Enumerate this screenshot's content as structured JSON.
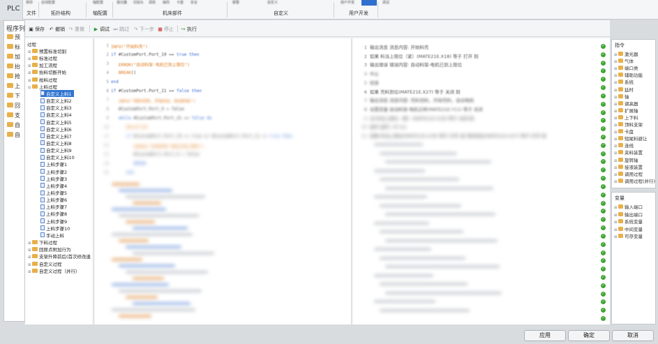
{
  "window": {
    "title": "PLC"
  },
  "ribbon": {
    "blurred_top": [
      "保存",
      "总线配置",
      "轴配置",
      "激光器",
      "切割头",
      "调高",
      "抽风",
      "卡盘",
      "安全",
      "报警",
      "自定义",
      "用户开发",
      "调试"
    ],
    "groups": [
      "文件",
      "拓扑结构",
      "轴配置",
      "机床部件",
      "自定义",
      "用户开发"
    ]
  },
  "left_panel": {
    "title": "程序列表",
    "items": [
      "预",
      "标",
      "加",
      "抬",
      "抢",
      "上",
      "下",
      "回",
      "支",
      "自",
      "自"
    ]
  },
  "toolbar": {
    "save": "保存",
    "undo": "撤销",
    "redo": "重做",
    "debug": "调试",
    "skip": "跳过",
    "step": "下一步",
    "stop": "停止",
    "run": "执行"
  },
  "tree": {
    "root": "过程",
    "items": [
      {
        "label": "预置标准切割",
        "level": 1,
        "kind": "folder",
        "tog": "+"
      },
      {
        "label": "标准过程",
        "level": 1,
        "kind": "folder",
        "tog": "+"
      },
      {
        "label": "加工流程",
        "level": 1,
        "kind": "folder",
        "tog": "+"
      },
      {
        "label": "抬料切断开始",
        "level": 1,
        "kind": "folder",
        "tog": "+"
      },
      {
        "label": "抢料过程",
        "level": 1,
        "kind": "folder",
        "tog": "+"
      },
      {
        "label": "上料过程",
        "level": 1,
        "kind": "folder",
        "tog": "-"
      },
      {
        "label": "自定义上料1",
        "level": 2,
        "kind": "doc",
        "selected": true
      },
      {
        "label": "自定义上料2",
        "level": 2,
        "kind": "doc"
      },
      {
        "label": "自定义上料3",
        "level": 2,
        "kind": "doc"
      },
      {
        "label": "自定义上料4",
        "level": 2,
        "kind": "doc"
      },
      {
        "label": "自定义上料5",
        "level": 2,
        "kind": "doc"
      },
      {
        "label": "自定义上料6",
        "level": 2,
        "kind": "doc"
      },
      {
        "label": "自定义上料7",
        "level": 2,
        "kind": "doc"
      },
      {
        "label": "自定义上料8",
        "level": 2,
        "kind": "doc"
      },
      {
        "label": "自定义上料9",
        "level": 2,
        "kind": "doc"
      },
      {
        "label": "自定义上料10",
        "level": 2,
        "kind": "doc"
      },
      {
        "label": "上料步骤1",
        "level": 2,
        "kind": "doc"
      },
      {
        "label": "上料步骤2",
        "level": 2,
        "kind": "doc"
      },
      {
        "label": "上料步骤3",
        "level": 2,
        "kind": "doc"
      },
      {
        "label": "上料步骤4",
        "level": 2,
        "kind": "doc"
      },
      {
        "label": "上料步骤5",
        "level": 2,
        "kind": "doc"
      },
      {
        "label": "上料步骤6",
        "level": 2,
        "kind": "doc"
      },
      {
        "label": "上料步骤7",
        "level": 2,
        "kind": "doc"
      },
      {
        "label": "上料步骤8",
        "level": 2,
        "kind": "doc"
      },
      {
        "label": "上料步骤9",
        "level": 2,
        "kind": "doc"
      },
      {
        "label": "上料步骤10",
        "level": 2,
        "kind": "doc"
      },
      {
        "label": "手动上料",
        "level": 2,
        "kind": "doc"
      },
      {
        "label": "下料过程",
        "level": 1,
        "kind": "folder",
        "tog": "+"
      },
      {
        "label": "回原点附加行为",
        "level": 1,
        "kind": "folder",
        "tog": "+"
      },
      {
        "label": "支架升降前后(首次修改逢",
        "level": 1,
        "kind": "folder",
        "tog": "+"
      },
      {
        "label": "自定义过程",
        "level": 1,
        "kind": "folder",
        "tog": "+"
      },
      {
        "label": "自定义过程（并行）",
        "level": 1,
        "kind": "folder",
        "tog": "+"
      }
    ]
  },
  "code": {
    "lines": [
      {
        "n": "1",
        "html": "<span class='st'>INFO(\"开始料壳\")</span>",
        "blur": 1
      },
      {
        "n": "2",
        "html": "<span class='kw'>if</span> <span class='pl'>#CustomPort.Port_19 ==</span> <span class='kw'>true then</span>",
        "blur": 1
      },
      {
        "n": "3",
        "html": "&nbsp;&nbsp;&nbsp;<span class='st'>ERROR(\"自动料架-电机已到上限位\")</span>",
        "blur": 1
      },
      {
        "n": "4",
        "html": "&nbsp;&nbsp;&nbsp;<span class='st'>BREAK</span><span class='pl'>()</span>",
        "blur": 1
      },
      {
        "n": "5",
        "html": "<span class='kw'>end</span>",
        "blur": 1
      },
      {
        "n": "6",
        "html": "<span class='kw'>if</span> <span class='pl'>#CustomPort.Port_21 ==</span> <span class='kw'>false then</span>",
        "blur": 1
      },
      {
        "n": "7",
        "html": "&nbsp;&nbsp;&nbsp;<span class='st'>INFO(\"壳料完料，开始向0，自动料机\")</span>",
        "blur": 2
      },
      {
        "n": "8",
        "html": "&nbsp;&nbsp;&nbsp;<span class='pl'>#CustomPort.Port_9 = false</span>",
        "blur": 2
      },
      {
        "n": "9",
        "html": "&nbsp;&nbsp;&nbsp;<span class='kw'>while</span> <span class='pl'>#CustomPort.Port_21 ==</span> <span class='kw'>false do</span>",
        "blur": 2
      },
      {
        "n": "10",
        "html": "&nbsp;&nbsp;&nbsp;&nbsp;&nbsp;&nbsp;<span class='st'>DELAY(20)</span>",
        "blur": 3
      },
      {
        "n": "11",
        "html": "&nbsp;&nbsp;&nbsp;&nbsp;&nbsp;&nbsp;<span class='kw'>if</span> <span class='pl'>#CustomPort.Port_19 == true or #CustomPort.Port_21 ==</span> <span class='kw'>true then</span>",
        "blur": 3
      },
      {
        "n": "12",
        "html": "&nbsp;&nbsp;&nbsp;&nbsp;&nbsp;&nbsp;&nbsp;&nbsp;&nbsp;<span class='st'>ERROR(\"自动料架-电机已到上限位\")</span>",
        "blur": 3
      },
      {
        "n": "13",
        "html": "&nbsp;&nbsp;&nbsp;&nbsp;&nbsp;&nbsp;&nbsp;&nbsp;&nbsp;<span class='pl'>#CustomPort.Port_9 = false</span>",
        "blur": 3
      },
      {
        "n": "14",
        "html": "&nbsp;&nbsp;&nbsp;&nbsp;&nbsp;&nbsp;&nbsp;&nbsp;&nbsp;<span class='kw'>BREAK</span>",
        "blur": 3
      },
      {
        "n": "15",
        "html": "&nbsp;&nbsp;&nbsp;&nbsp;&nbsp;&nbsp;<span class='kw'>end</span>",
        "blur": 3
      }
    ]
  },
  "desc": {
    "lines": [
      {
        "n": "1",
        "text": "输出消息  消息内容: 开始料壳",
        "blur": 1
      },
      {
        "n": "2",
        "text": "如果 料当上限位（紧）(MATE21E.X18) 等于 打开 则",
        "blur": 1
      },
      {
        "n": "3",
        "text": "输出错误  错误内容: 自动料架-电机已到上限位",
        "blur": 1
      },
      {
        "n": "4",
        "text": "中止",
        "blur": 2
      },
      {
        "n": "5",
        "text": "结束",
        "blur": 2
      },
      {
        "n": "6",
        "text": "如果 壳料到位(MATE21E.X27) 等于 关闭 则",
        "blur": 1
      },
      {
        "n": "7",
        "text": "输出消息  消息内容: 壳料完料，开始壳料，自动电机",
        "blur": 2
      },
      {
        "n": "8",
        "text": "设置变量 自动料架-电机正转(MATE21E.Y11) 等于 关闭",
        "blur": 2
      },
      {
        "n": "9",
        "text": "当 料当上限位（紧）(MATE21E.X18) 等于 关闭 则",
        "blur": 3
      },
      {
        "n": "10",
        "text": "延时 延时: 20 ms",
        "blur": 3
      },
      {
        "n": "11",
        "text": "如果 料当上限位(MATE21E.X18) 等于 打开 或 壳料到位(MATE21E.X27) 等于 打开 则",
        "blur": 3
      }
    ],
    "check_count": 34
  },
  "instructions_panel": {
    "title": "指令",
    "items": [
      "激光器",
      "气体",
      "端口类",
      "辅助功能",
      "系统",
      "延时",
      "轴",
      "调高器",
      "扩展轴",
      "上下料",
      "顶料支架",
      "卡盘",
      "短尾料避让",
      "连线",
      "夹料装置",
      "旋转轴",
      "接液装置",
      "调用过程",
      "调用过程(并行)"
    ]
  },
  "variables_panel": {
    "title": "变量",
    "items": [
      "输入端口",
      "输出端口",
      "系统变量",
      "中间变量",
      "可存变量"
    ]
  },
  "buttons": {
    "apply": "应用",
    "ok": "确定",
    "cancel": "取消"
  },
  "colors": {
    "selection": "#2f74d0",
    "check": "#3fa535",
    "keyword": "#3b6fd6",
    "string": "#e07a1f",
    "folder": "#e8b04a"
  }
}
